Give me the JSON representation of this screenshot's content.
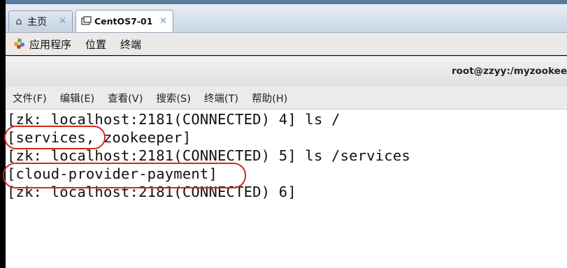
{
  "tabs": [
    {
      "label": "主页",
      "icon": "home-icon"
    },
    {
      "label": "CentOS7-01",
      "icon": "terminal-icon"
    }
  ],
  "close_glyph": "✕",
  "top_menu": {
    "applications": "应用程序",
    "places": "位置",
    "terminal": "终端"
  },
  "window": {
    "title": "root@zzyy:/myzookee"
  },
  "terminal_menu": [
    "文件(F)",
    "编辑(E)",
    "查看(V)",
    "搜索(S)",
    "终端(T)",
    "帮助(H)"
  ],
  "terminal_lines": [
    "[zk: localhost:2181(CONNECTED) 4] ls /",
    "[services, zookeeper]",
    "[zk: localhost:2181(CONNECTED) 5] ls /services",
    "[cloud-provider-payment]",
    "[zk: localhost:2181(CONNECTED) 6]"
  ],
  "colors": {
    "highlight_oval": "#d9251d",
    "tab_close": "#7d93b7"
  }
}
